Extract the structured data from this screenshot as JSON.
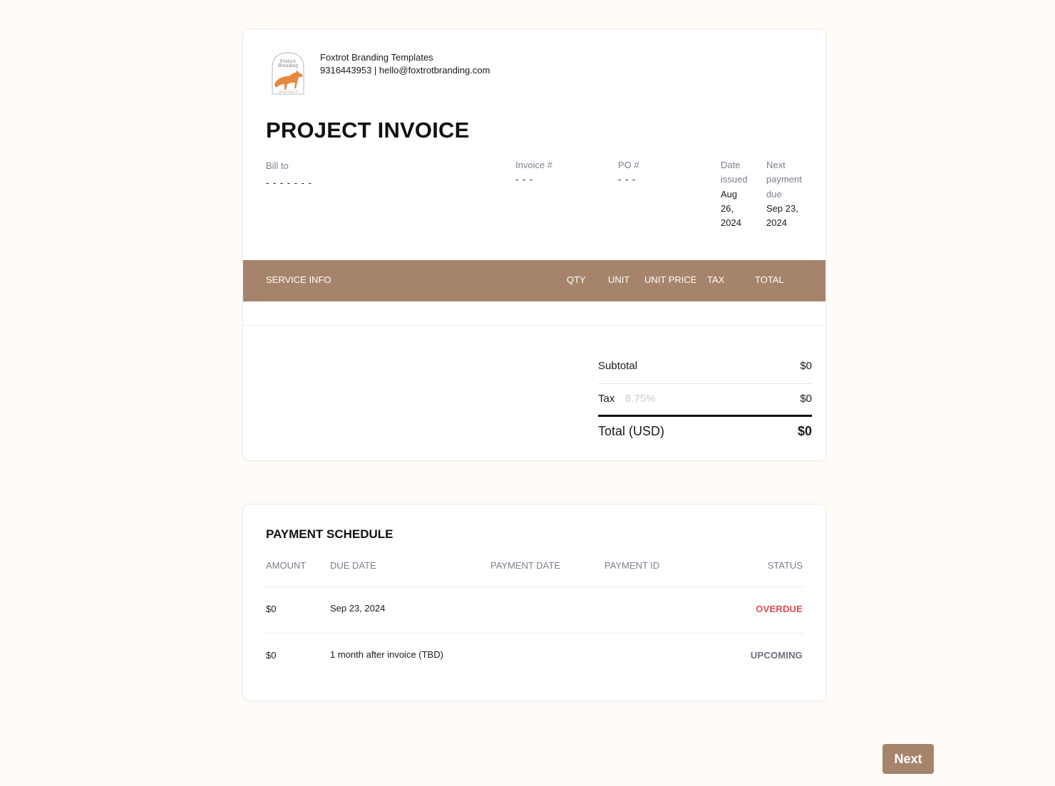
{
  "company": {
    "name": "Foxtrot Branding Templates",
    "contact": "9316443953 | hello@foxtrotbranding.com",
    "logo_text_line1": "Foxtrot",
    "logo_text_line2": "Branding",
    "logo_caption": "DESIGN CREATIVE"
  },
  "invoice": {
    "title": "PROJECT INVOICE",
    "bill_to_label": "Bill to",
    "bill_to_value": "- - - - - - -",
    "invoice_no_label": "Invoice #",
    "invoice_no_value": "- - -",
    "po_label": "PO #",
    "po_value": "- - -",
    "date_issued_label_1": "Date",
    "date_issued_label_2": "issued",
    "date_issued_value_1": "Aug",
    "date_issued_value_2": "26,",
    "date_issued_value_3": "2024",
    "next_due_label_1": "Next",
    "next_due_label_2": "payment",
    "next_due_label_3": "due",
    "next_due_value_1": "Sep 23,",
    "next_due_value_2": "2024"
  },
  "items_table": {
    "headers": [
      "SERVICE INFO",
      "QTY",
      "UNIT",
      "UNIT PRICE",
      "TAX",
      "TOTAL"
    ]
  },
  "totals": {
    "subtotal_label": "Subtotal",
    "subtotal_value": "$0",
    "tax_label": "Tax",
    "tax_rate": "8.75%",
    "tax_value": "$0",
    "total_label": "Total (USD)",
    "total_value": "$0"
  },
  "schedule": {
    "title": "PAYMENT SCHEDULE",
    "headers": [
      "AMOUNT",
      "DUE DATE",
      "PAYMENT DATE",
      "PAYMENT ID",
      "STATUS"
    ],
    "rows": [
      {
        "amount": "$0",
        "due_date": "Sep 23, 2024",
        "payment_date": "",
        "payment_id": "",
        "status": "OVERDUE",
        "status_color": "#e5484d"
      },
      {
        "amount": "$0",
        "due_date": "1 month after invoice (TBD)",
        "payment_date": "",
        "payment_id": "",
        "status": "UPCOMING",
        "status_color": "#6b6f7a"
      }
    ]
  },
  "actions": {
    "next_label": "Next"
  },
  "colors": {
    "accent": "#a5846b",
    "background": "#fffcf7",
    "overdue": "#e5484d",
    "muted": "#7b7f8a"
  }
}
